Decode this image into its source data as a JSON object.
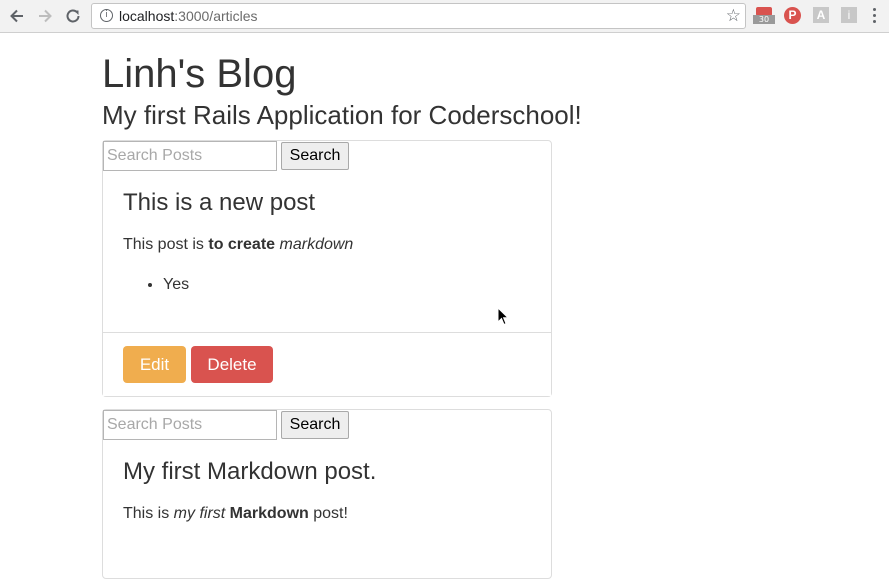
{
  "browser": {
    "url_host": "localhost",
    "url_path": ":3000/articles",
    "gmail_count": "30",
    "pinterest_label": "P",
    "ext_a_label": "A",
    "ext_i_label": "i",
    "icons": [
      "back-arrow-icon",
      "forward-arrow-icon",
      "reload-icon",
      "info-icon",
      "star-icon",
      "gmail-icon",
      "pinterest-icon",
      "menu-icon"
    ]
  },
  "blog": {
    "title": "Linh's Blog",
    "subtitle": "My first Rails Application for Coderschool!"
  },
  "search": {
    "placeholder": "Search Posts",
    "button_label": "Search"
  },
  "posts": [
    {
      "title": "This is a new post",
      "body_prefix": "This post is ",
      "body_bold": "to create",
      "body_space": " ",
      "body_italic": "markdown",
      "list_items": [
        "Yes"
      ],
      "edit_label": "Edit",
      "delete_label": "Delete"
    },
    {
      "title": "My first Markdown post.",
      "body_prefix": "This is ",
      "body_italic": "my first",
      "body_space": " ",
      "body_bold": "Markdown",
      "body_suffix": " post!"
    }
  ],
  "colors": {
    "edit": "#f0ad4e",
    "delete": "#d9534f",
    "text": "#333333",
    "border": "#dddddd"
  }
}
